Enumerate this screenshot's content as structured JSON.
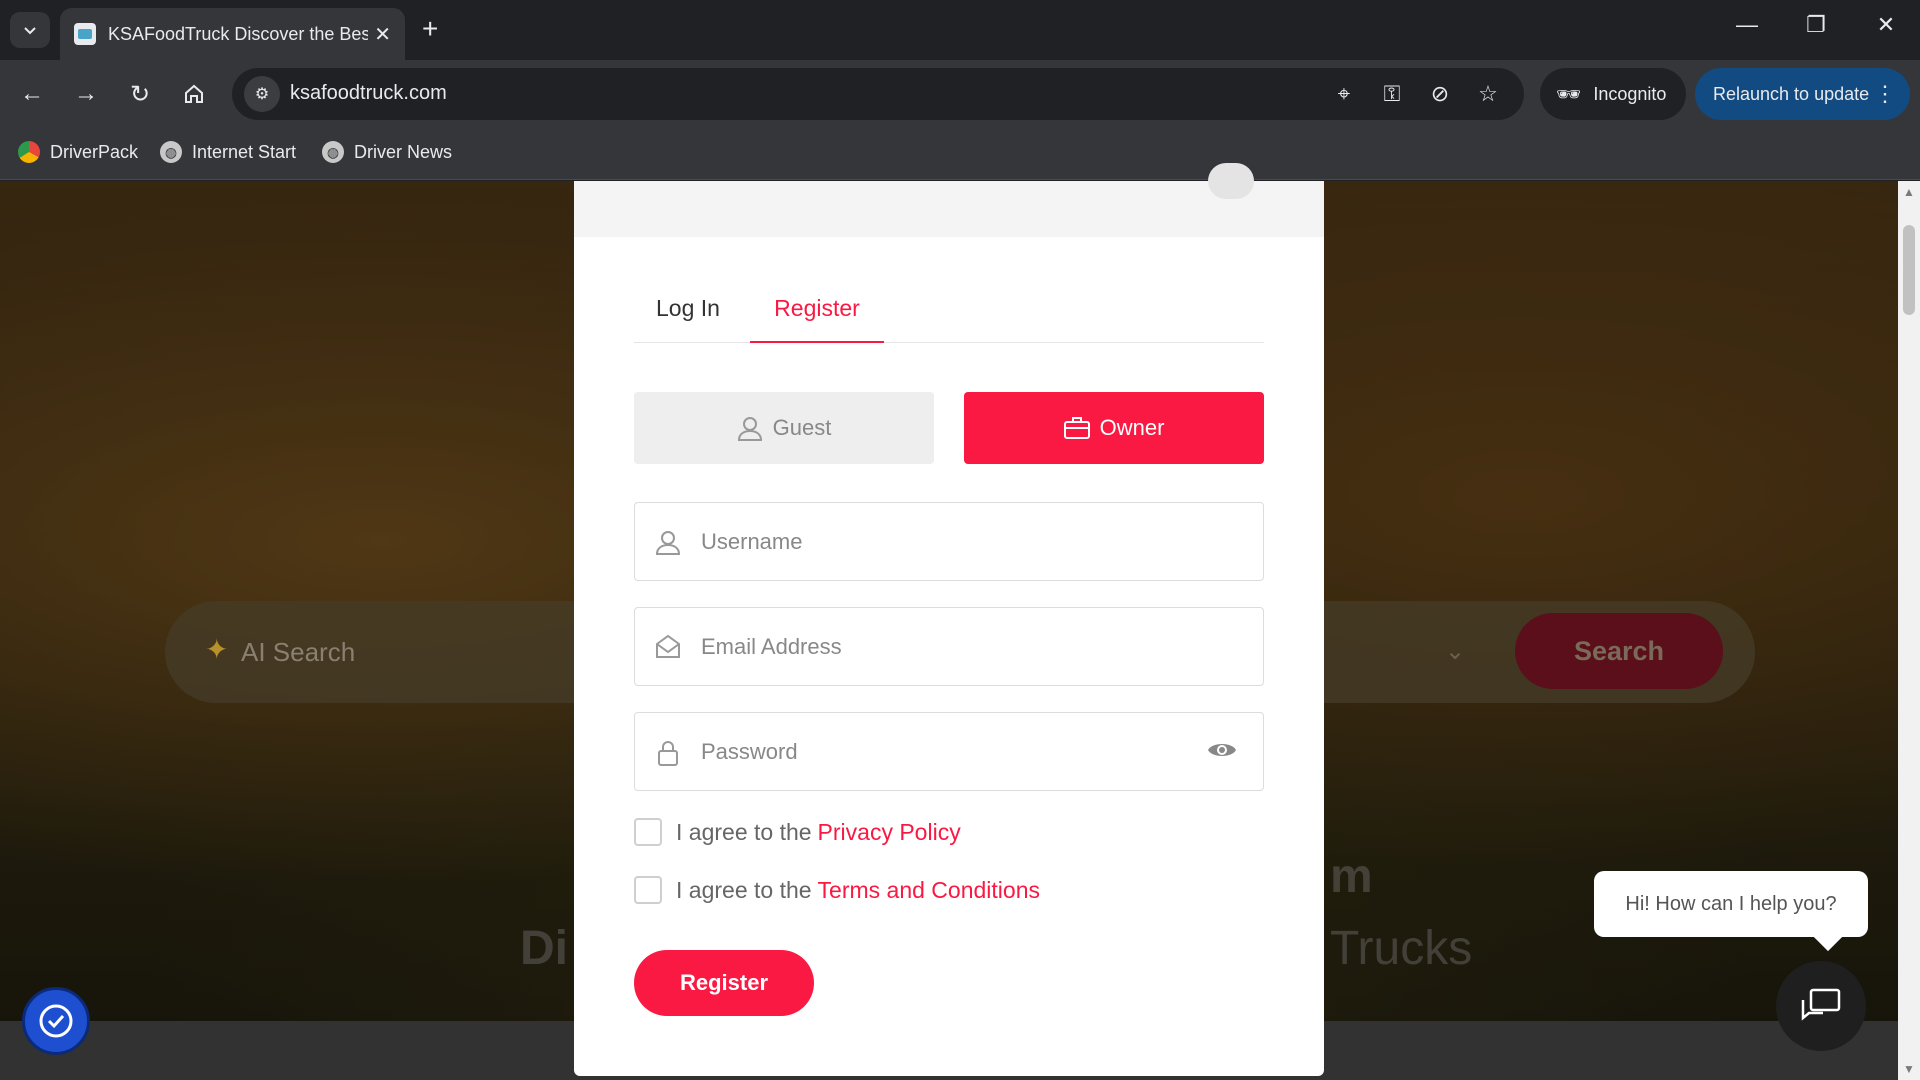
{
  "browser": {
    "tab_title": "KSAFoodTruck Discover the Bes",
    "url": "ksafoodtruck.com",
    "incognito_label": "Incognito",
    "relaunch_label": "Relaunch to update",
    "bookmarks": [
      {
        "label": "DriverPack",
        "icon": "driverpack-icon"
      },
      {
        "label": "Internet Start",
        "icon": "globe-icon"
      },
      {
        "label": "Driver News",
        "icon": "globe-icon"
      }
    ],
    "colors": {
      "frame": "#202124",
      "toolbar": "#35363a",
      "relaunch": "#124a82"
    }
  },
  "background": {
    "search_placeholder": "AI Search",
    "search_button": "Search",
    "partial_text_1": "Di",
    "partial_text_2": "m",
    "partial_text_3": "Trucks"
  },
  "modal": {
    "tabs": [
      {
        "label": "Log In",
        "active": false
      },
      {
        "label": "Register",
        "active": true
      }
    ],
    "roles": [
      {
        "label": "Guest",
        "icon": "user-icon",
        "selected": false
      },
      {
        "label": "Owner",
        "icon": "briefcase-icon",
        "selected": true
      }
    ],
    "fields": {
      "username_placeholder": "Username",
      "email_placeholder": "Email Address",
      "password_placeholder": "Password"
    },
    "checks": [
      {
        "prefix": "I agree to the",
        "link": "Privacy Policy"
      },
      {
        "prefix": "I agree to the",
        "link": "Terms and Conditions"
      }
    ],
    "register_button": "Register",
    "accent_color": "#f91942"
  },
  "chat": {
    "bubble_text": "Hi! How can I help you?"
  }
}
